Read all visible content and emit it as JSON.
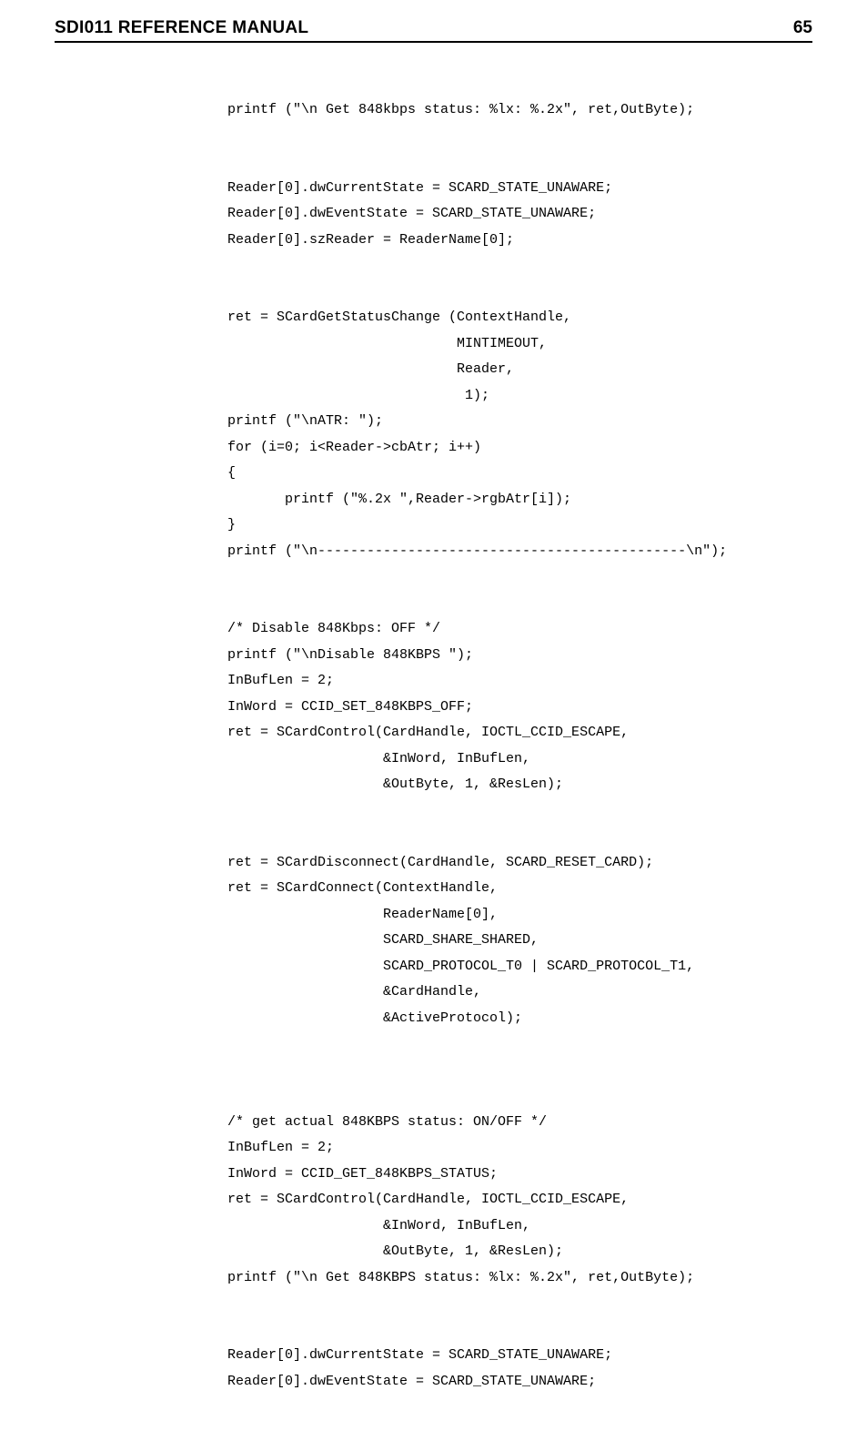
{
  "header": {
    "title_prefix": "SDI011 R",
    "title_rest": "EFERENCE",
    "title_word2_prefix": "M",
    "title_word2_rest": "ANUAL",
    "page_number": "65"
  },
  "code": "printf (\"\\n Get 848kbps status: %lx: %.2x\", ret,OutByte);\n\n\nReader[0].dwCurrentState = SCARD_STATE_UNAWARE;\nReader[0].dwEventState = SCARD_STATE_UNAWARE;\nReader[0].szReader = ReaderName[0];\n\n\nret = SCardGetStatusChange (ContextHandle,\n                            MINTIMEOUT,\n                            Reader,\n                             1);\nprintf (\"\\nATR: \");\nfor (i=0; i<Reader->cbAtr; i++)\n{\n       printf (\"%.2x \",Reader->rgbAtr[i]);\n}\nprintf (\"\\n---------------------------------------------\\n\");\n\n\n/* Disable 848Kbps: OFF */\nprintf (\"\\nDisable 848KBPS \");\nInBufLen = 2;\nInWord = CCID_SET_848KBPS_OFF;\nret = SCardControl(CardHandle, IOCTL_CCID_ESCAPE,\n                   &InWord, InBufLen,\n                   &OutByte, 1, &ResLen);\n\n\nret = SCardDisconnect(CardHandle, SCARD_RESET_CARD);\nret = SCardConnect(ContextHandle,\n                   ReaderName[0],\n                   SCARD_SHARE_SHARED,\n                   SCARD_PROTOCOL_T0 | SCARD_PROTOCOL_T1,\n                   &CardHandle,\n                   &ActiveProtocol);\n\n\n\n/* get actual 848KBPS status: ON/OFF */\nInBufLen = 2;\nInWord = CCID_GET_848KBPS_STATUS;\nret = SCardControl(CardHandle, IOCTL_CCID_ESCAPE,\n                   &InWord, InBufLen,\n                   &OutByte, 1, &ResLen);\nprintf (\"\\n Get 848KBPS status: %lx: %.2x\", ret,OutByte);\n\n\nReader[0].dwCurrentState = SCARD_STATE_UNAWARE;\nReader[0].dwEventState = SCARD_STATE_UNAWARE;"
}
